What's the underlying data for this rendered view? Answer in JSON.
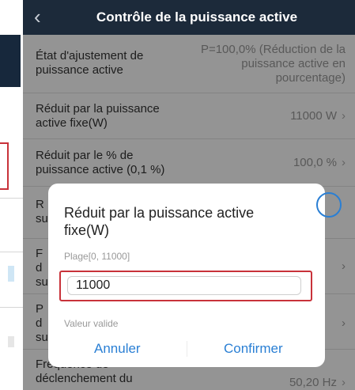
{
  "header": {
    "back_icon": "chevron-left-icon",
    "title": "Contrôle de la puissance active"
  },
  "rows": [
    {
      "label": "État d'ajustement de puissance active",
      "value": "P=100,0% (Réduction de la puissance active en pourcentage)"
    },
    {
      "label": "Réduit par la puissance active fixe(W)",
      "value": "11000 W"
    },
    {
      "label": "Réduit par le % de puissance active (0,1 %)",
      "value": "100,0 %"
    },
    {
      "label": "R\nsu",
      "value": ""
    },
    {
      "label": "F\nd\nsu",
      "value": ""
    },
    {
      "label": "P\nd\nsu",
      "value": ""
    },
    {
      "label": "Fréquence de déclenchement du",
      "value": "50,20 Hz"
    }
  ],
  "dialog": {
    "title": "Réduit par la puissance active fixe(W)",
    "range": "Plage[0, 11000]",
    "input_value": "11000",
    "validity": "Valeur valide",
    "cancel_label": "Annuler",
    "confirm_label": "Confirmer"
  },
  "colors": {
    "header_bg": "#1c2a3a",
    "accent": "#2a7fd4",
    "highlight": "#c8323a"
  }
}
